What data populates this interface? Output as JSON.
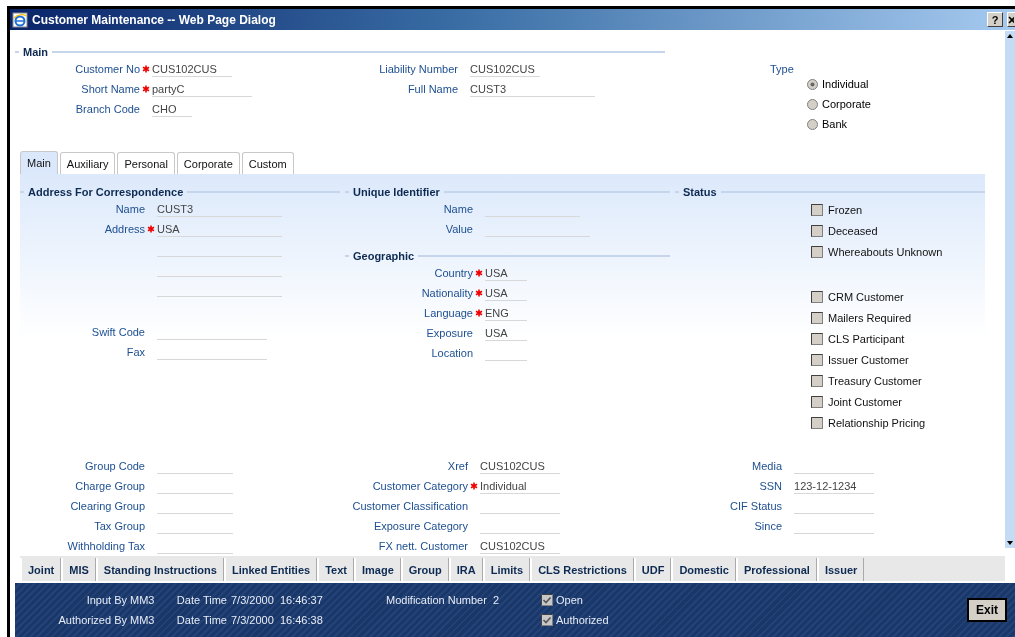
{
  "window": {
    "title": "Customer Maintenance -- Web Page Dialog",
    "help": "?"
  },
  "main": {
    "legend": "Main",
    "fields": [
      {
        "label": "Customer No",
        "required": true,
        "value": "CUS102CUS"
      },
      {
        "label": "Short Name",
        "required": true,
        "value": "partyC"
      },
      {
        "label": "Branch Code",
        "required": false,
        "value": "CHO"
      }
    ],
    "fields_2": [
      {
        "label": "Liability Number",
        "required": false,
        "value": "CUS102CUS"
      },
      {
        "label": "Full Name",
        "required": false,
        "value": "CUST3"
      }
    ],
    "type": {
      "label": "Type",
      "options": [
        {
          "label": "Individual",
          "selected": true
        },
        {
          "label": "Corporate",
          "selected": false
        },
        {
          "label": "Bank",
          "selected": false
        }
      ]
    }
  },
  "tabs": [
    {
      "label": "Main",
      "selected": true
    },
    {
      "label": "Auxiliary",
      "selected": false
    },
    {
      "label": "Personal",
      "selected": false
    },
    {
      "label": "Corporate",
      "selected": false
    },
    {
      "label": "Custom",
      "selected": false
    }
  ],
  "address": {
    "legend": "Address For Correspondence",
    "fields": [
      {
        "kind": "field",
        "label": "Name",
        "required": false,
        "value": "CUST3"
      },
      {
        "kind": "field",
        "label": "Address",
        "required": true,
        "value": "USA"
      },
      {
        "kind": "continuation"
      },
      {
        "kind": "continuation"
      },
      {
        "kind": "continuation"
      }
    ],
    "contact_fields": [
      {
        "label": "Swift Code",
        "required": false
      },
      {
        "label": "Fax",
        "required": false
      }
    ]
  },
  "unique_identifier": {
    "legend": "Unique Identifier",
    "fields": [
      {
        "label": "Name",
        "required": false
      },
      {
        "label": "Value",
        "required": false
      }
    ]
  },
  "geographic": {
    "legend": "Geographic",
    "fields": [
      {
        "label": "Country",
        "required": true,
        "value": "USA"
      },
      {
        "label": "Nationality",
        "required": true,
        "value": "USA"
      },
      {
        "label": "Language",
        "required": true,
        "value": "ENG"
      },
      {
        "label": "Exposure",
        "required": false,
        "value": "USA"
      },
      {
        "label": "Location",
        "required": false
      }
    ]
  },
  "status": {
    "legend": "Status",
    "flags": [
      {
        "label": "Frozen",
        "checked": false
      },
      {
        "label": "Deceased",
        "checked": false
      },
      {
        "label": "Whereabouts Unknown",
        "checked": false
      }
    ],
    "flags_2": [
      {
        "label": "CRM Customer",
        "checked": false
      },
      {
        "label": "Mailers Required",
        "checked": false
      },
      {
        "label": "CLS Participant",
        "checked": false
      },
      {
        "label": "Issuer Customer",
        "checked": false
      },
      {
        "label": "Treasury Customer",
        "checked": false
      },
      {
        "label": "Joint Customer",
        "checked": false
      },
      {
        "label": "Relationship Pricing",
        "checked": false
      }
    ]
  },
  "other_fields": [
    [
      {
        "label": "Group Code",
        "required": false
      },
      {
        "label": "Charge Group",
        "required": false
      },
      {
        "label": "Clearing Group",
        "required": false
      },
      {
        "label": "Tax Group",
        "required": false
      },
      {
        "label": "Withholding Tax",
        "required": false
      }
    ],
    [
      {
        "label": "Xref",
        "required": false,
        "value": "CUS102CUS"
      },
      {
        "label": "Customer Category",
        "required": true,
        "value": "Individual"
      },
      {
        "label": "Customer Classification",
        "required": false
      },
      {
        "label": "Exposure Category",
        "required": false
      },
      {
        "label": "FX nett. Customer",
        "required": false,
        "value": "CUS102CUS"
      }
    ],
    [
      {
        "label": "Media",
        "required": false
      },
      {
        "label": "SSN",
        "required": false,
        "value": "123-12-1234"
      },
      {
        "label": "CIF Status",
        "required": false
      },
      {
        "label": "Since",
        "required": false
      }
    ]
  ],
  "buttons": [
    "Joint",
    "MIS",
    "Standing Instructions",
    "Linked Entities",
    "Text",
    "Image",
    "Group",
    "IRA",
    "Limits",
    "CLS Restrictions",
    "UDF",
    "Domestic",
    "Professional",
    "Issuer"
  ],
  "audit": {
    "rows": [
      {
        "by_label": "Input By",
        "by": "MM3",
        "time_label": "Date Time",
        "time": "7/3/2000  16:46:37"
      },
      {
        "by_label": "Authorized By",
        "by": "MM3",
        "time_label": "Date Time",
        "time": "7/3/2000  16:46:38"
      }
    ],
    "modification_label": "Modification Number",
    "modification": "2",
    "flags": [
      {
        "label": "Open",
        "checked": true
      },
      {
        "label": "Authorized",
        "checked": true
      }
    ],
    "exit": "Exit"
  }
}
